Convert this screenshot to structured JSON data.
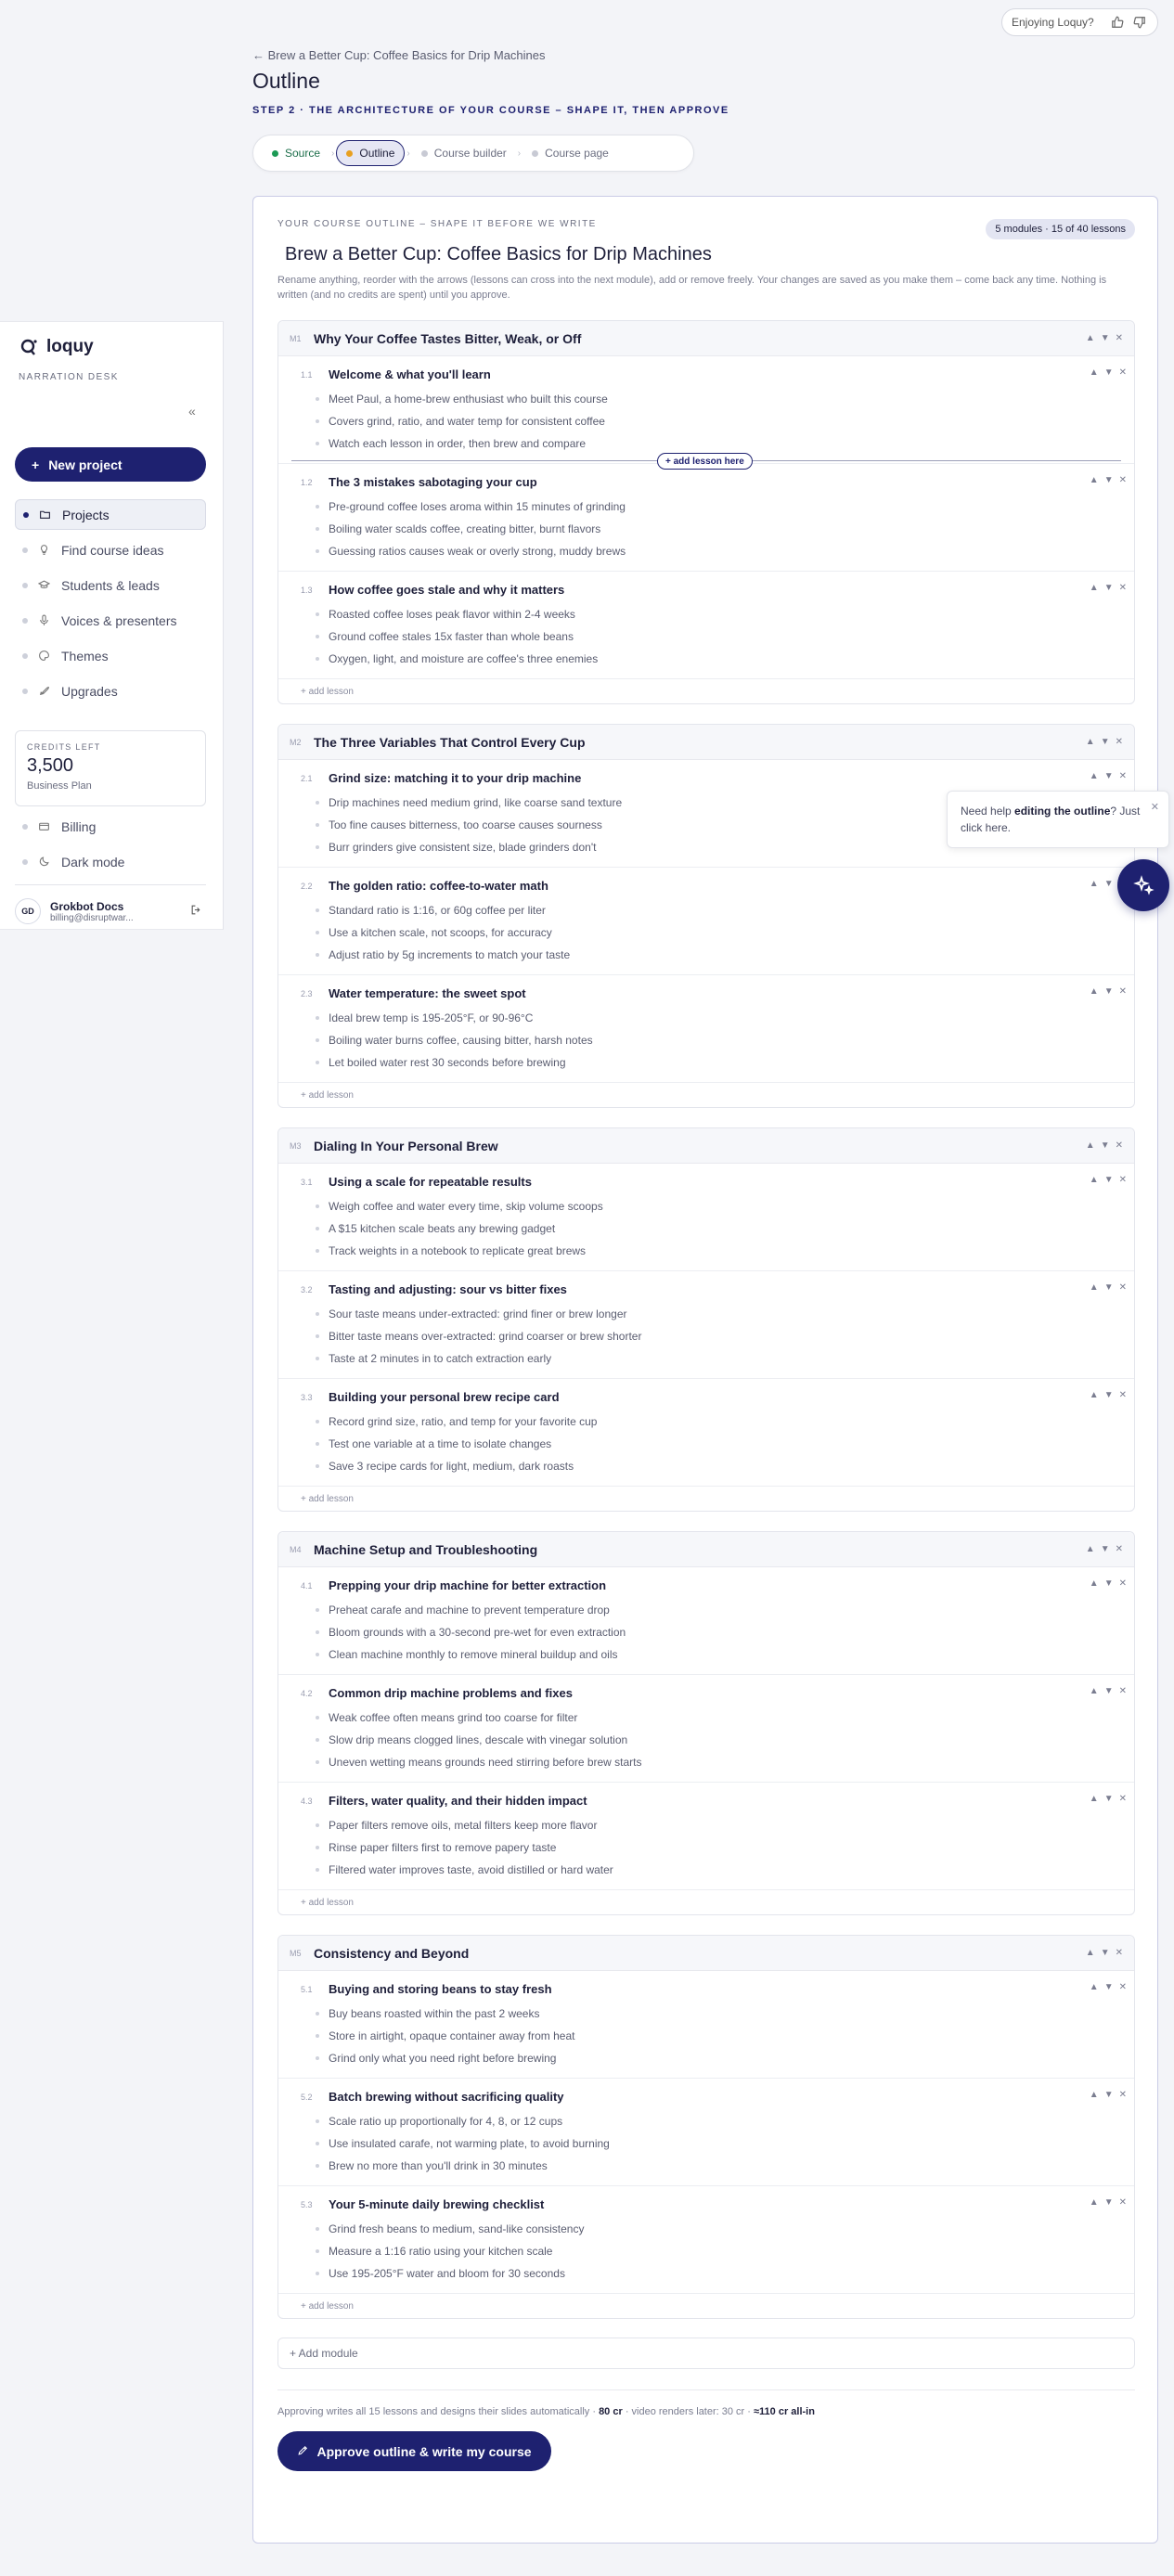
{
  "feedback": {
    "label": "Enjoying Loquy?"
  },
  "sidebar": {
    "brand": "loquy",
    "subtitle": "NARRATION DESK",
    "collapse": "«",
    "new_project": "New project",
    "items": [
      {
        "label": "Projects",
        "icon": "folder-icon"
      },
      {
        "label": "Find course ideas",
        "icon": "lightbulb-icon"
      },
      {
        "label": "Students & leads",
        "icon": "graduation-cap-icon"
      },
      {
        "label": "Voices & presenters",
        "icon": "microphone-icon"
      },
      {
        "label": "Themes",
        "icon": "palette-icon"
      },
      {
        "label": "Upgrades",
        "icon": "rocket-icon"
      }
    ],
    "credits": {
      "label": "CREDITS LEFT",
      "value": "3,500",
      "plan": "Business Plan"
    },
    "bottom_items": [
      {
        "label": "Billing",
        "icon": "credit-card-icon"
      },
      {
        "label": "Dark mode",
        "icon": "moon-icon"
      }
    ],
    "user": {
      "initials": "GD",
      "name": "Grokbot Docs",
      "email": "billing@disruptwar..."
    }
  },
  "header": {
    "back": "← Brew a Better Cup: Coffee Basics for Drip Machines",
    "title": "Outline",
    "step": "STEP 2 · THE ARCHITECTURE OF YOUR COURSE – SHAPE IT, THEN APPROVE",
    "steps": [
      "Source",
      "Outline",
      "Course builder",
      "Course page"
    ]
  },
  "outline": {
    "kicker": "YOUR COURSE OUTLINE – SHAPE IT BEFORE WE WRITE",
    "count": "5 modules · 15 of 40 lessons",
    "title": "Brew a Better Cup: Coffee Basics for Drip Machines",
    "help": "Rename anything, reorder with the arrows (lessons can cross into the next module), add or remove freely. Your changes are saved as you make them – come back any time. Nothing is written (and no credits are spent) until you approve.",
    "add_lesson_here": "+ add lesson here",
    "add_lesson": "+ add lesson",
    "add_module": "+ Add module",
    "modules": [
      {
        "num": "M1",
        "title": "Why Your Coffee Tastes Bitter, Weak, or Off",
        "lessons": [
          {
            "num": "1.1",
            "title": "Welcome & what you'll learn",
            "bullets": [
              "Meet Paul, a home-brew enthusiast who built this course",
              "Covers grind, ratio, and water temp for consistent coffee",
              "Watch each lesson in order, then brew and compare"
            ]
          },
          {
            "num": "1.2",
            "title": "The 3 mistakes sabotaging your cup",
            "bullets": [
              "Pre-ground coffee loses aroma within 15 minutes of grinding",
              "Boiling water scalds coffee, creating bitter, burnt flavors",
              "Guessing ratios causes weak or overly strong, muddy brews"
            ]
          },
          {
            "num": "1.3",
            "title": "How coffee goes stale and why it matters",
            "bullets": [
              "Roasted coffee loses peak flavor within 2-4 weeks",
              "Ground coffee stales 15x faster than whole beans",
              "Oxygen, light, and moisture are coffee's three enemies"
            ]
          }
        ]
      },
      {
        "num": "M2",
        "title": "The Three Variables That Control Every Cup",
        "lessons": [
          {
            "num": "2.1",
            "title": "Grind size: matching it to your drip machine",
            "bullets": [
              "Drip machines need medium grind, like coarse sand texture",
              "Too fine causes bitterness, too coarse causes sourness",
              "Burr grinders give consistent size, blade grinders don't"
            ]
          },
          {
            "num": "2.2",
            "title": "The golden ratio: coffee-to-water math",
            "bullets": [
              "Standard ratio is 1:16, or 60g coffee per liter",
              "Use a kitchen scale, not scoops, for accuracy",
              "Adjust ratio by 5g increments to match your taste"
            ]
          },
          {
            "num": "2.3",
            "title": "Water temperature: the sweet spot",
            "bullets": [
              "Ideal brew temp is 195-205°F, or 90-96°C",
              "Boiling water burns coffee, causing bitter, harsh notes",
              "Let boiled water rest 30 seconds before brewing"
            ]
          }
        ]
      },
      {
        "num": "M3",
        "title": "Dialing In Your Personal Brew",
        "lessons": [
          {
            "num": "3.1",
            "title": "Using a scale for repeatable results",
            "bullets": [
              "Weigh coffee and water every time, skip volume scoops",
              "A $15 kitchen scale beats any brewing gadget",
              "Track weights in a notebook to replicate great brews"
            ]
          },
          {
            "num": "3.2",
            "title": "Tasting and adjusting: sour vs bitter fixes",
            "bullets": [
              "Sour taste means under-extracted: grind finer or brew longer",
              "Bitter taste means over-extracted: grind coarser or brew shorter",
              "Taste at 2 minutes in to catch extraction early"
            ]
          },
          {
            "num": "3.3",
            "title": "Building your personal brew recipe card",
            "bullets": [
              "Record grind size, ratio, and temp for your favorite cup",
              "Test one variable at a time to isolate changes",
              "Save 3 recipe cards for light, medium, dark roasts"
            ]
          }
        ]
      },
      {
        "num": "M4",
        "title": "Machine Setup and Troubleshooting",
        "lessons": [
          {
            "num": "4.1",
            "title": "Prepping your drip machine for better extraction",
            "bullets": [
              "Preheat carafe and machine to prevent temperature drop",
              "Bloom grounds with a 30-second pre-wet for even extraction",
              "Clean machine monthly to remove mineral buildup and oils"
            ]
          },
          {
            "num": "4.2",
            "title": "Common drip machine problems and fixes",
            "bullets": [
              "Weak coffee often means grind too coarse for filter",
              "Slow drip means clogged lines, descale with vinegar solution",
              "Uneven wetting means grounds need stirring before brew starts"
            ]
          },
          {
            "num": "4.3",
            "title": "Filters, water quality, and their hidden impact",
            "bullets": [
              "Paper filters remove oils, metal filters keep more flavor",
              "Rinse paper filters first to remove papery taste",
              "Filtered water improves taste, avoid distilled or hard water"
            ]
          }
        ]
      },
      {
        "num": "M5",
        "title": "Consistency and Beyond",
        "lessons": [
          {
            "num": "5.1",
            "title": "Buying and storing beans to stay fresh",
            "bullets": [
              "Buy beans roasted within the past 2 weeks",
              "Store in airtight, opaque container away from heat",
              "Grind only what you need right before brewing"
            ]
          },
          {
            "num": "5.2",
            "title": "Batch brewing without sacrificing quality",
            "bullets": [
              "Scale ratio up proportionally for 4, 8, or 12 cups",
              "Use insulated carafe, not warming plate, to avoid burning",
              "Brew no more than you'll drink in 30 minutes"
            ]
          },
          {
            "num": "5.3",
            "title": "Your 5-minute daily brewing checklist",
            "bullets": [
              "Grind fresh beans to medium, sand-like consistency",
              "Measure a 1:16 ratio using your kitchen scale",
              "Use 195-205°F water and bloom for 30 seconds"
            ]
          }
        ]
      }
    ],
    "approve_note": {
      "prefix": "Approving writes all 15 lessons and designs their slides automatically · ",
      "cost": "80 cr",
      "middle": " · video renders later: 30 cr · ",
      "total": "≈110 cr all-in"
    },
    "approve_button": "Approve outline & write my course"
  },
  "popup": {
    "prefix": "Need help ",
    "bold": "editing the outline",
    "suffix": "? Just click here."
  }
}
